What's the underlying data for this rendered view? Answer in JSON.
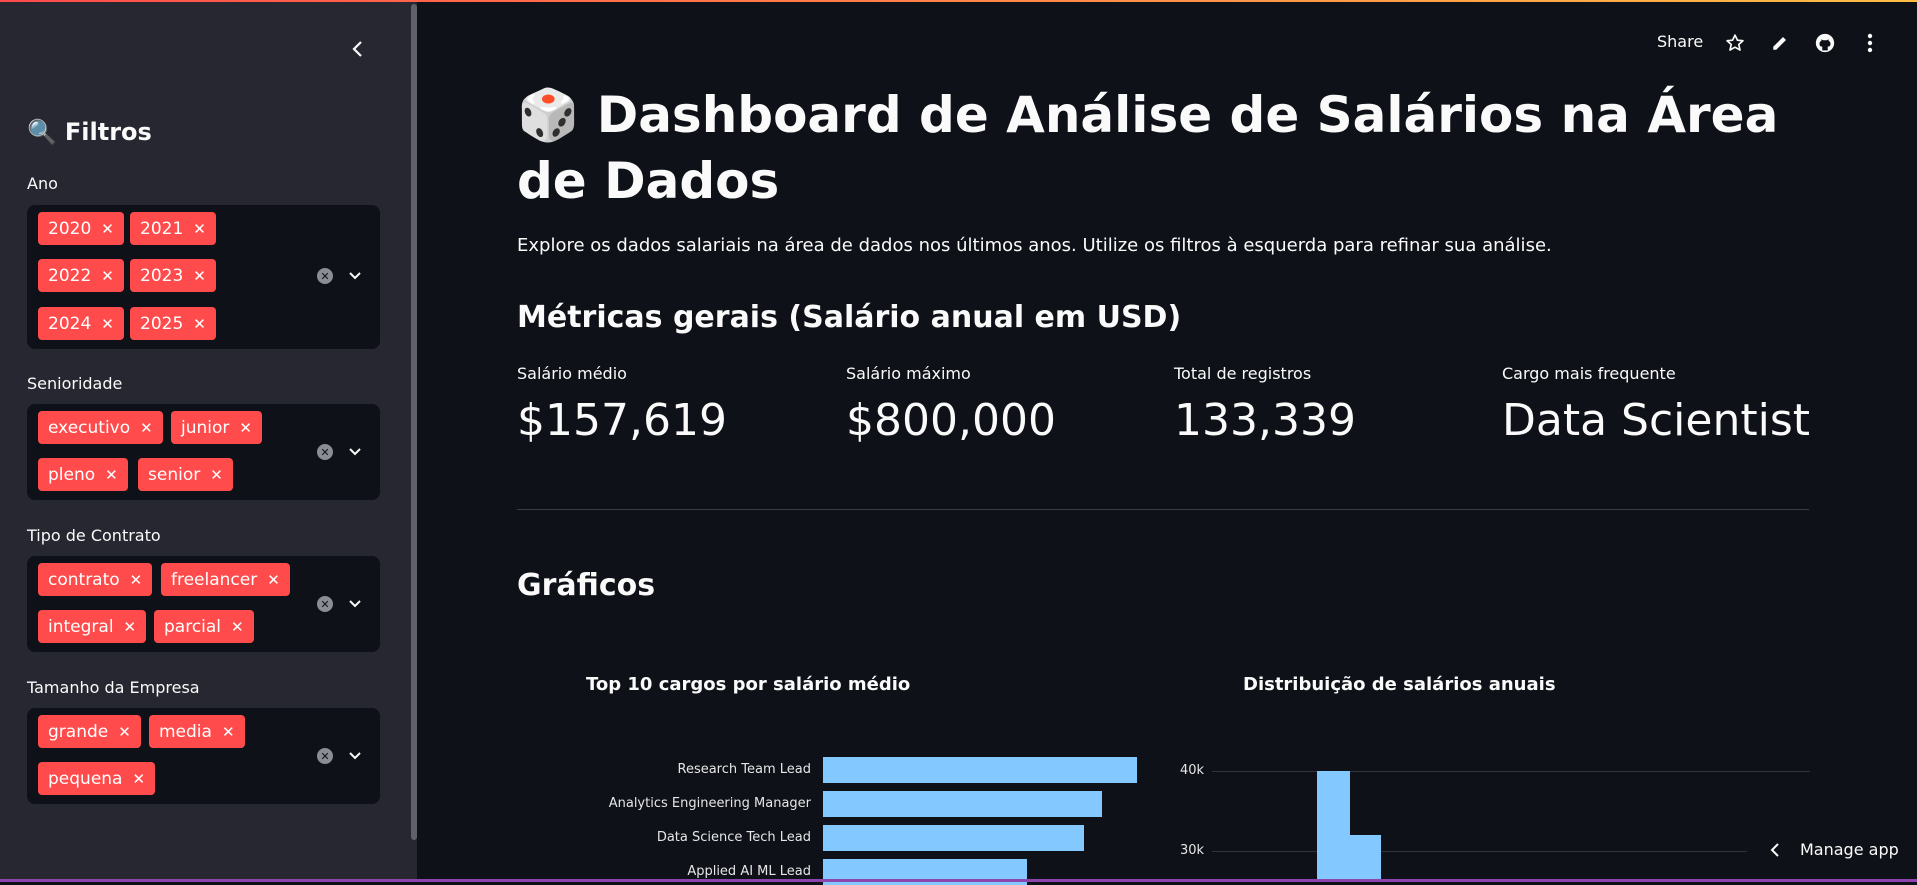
{
  "sidebar": {
    "title": "Filtros",
    "title_icon": "🔍",
    "filters": [
      {
        "label": "Ano",
        "tags": [
          "2020",
          "2021",
          "2022",
          "2023",
          "2024",
          "2025"
        ]
      },
      {
        "label": "Senioridade",
        "tags": [
          "executivo",
          "junior",
          "pleno",
          "senior"
        ]
      },
      {
        "label": "Tipo de Contrato",
        "tags": [
          "contrato",
          "freelancer",
          "integral",
          "parcial"
        ]
      },
      {
        "label": "Tamanho da Empresa",
        "tags": [
          "grande",
          "media",
          "pequena"
        ]
      }
    ],
    "tag_color": "#ff4b4b"
  },
  "header": {
    "share_label": "Share",
    "icons": [
      "star-icon",
      "pencil-icon",
      "github-icon",
      "more-menu-icon"
    ]
  },
  "main": {
    "title_emoji": "🎲",
    "title": "Dashboard de Análise de Salários na Área de Dados",
    "intro": "Explore os dados salariais na área de dados nos últimos anos. Utilize os filtros à esquerda para refinar sua análise.",
    "metrics_heading": "Métricas gerais (Salário anual em USD)",
    "metrics": [
      {
        "label": "Salário médio",
        "value": "$157,619"
      },
      {
        "label": "Salário máximo",
        "value": "$800,000"
      },
      {
        "label": "Total de registros",
        "value": "133,339"
      },
      {
        "label": "Cargo mais frequente",
        "value": "Data Scientist"
      }
    ],
    "charts_heading": "Gráficos"
  },
  "chart_data": [
    {
      "type": "bar",
      "title": "Top 10 cargos por salário médio",
      "orientation": "horizontal",
      "categories": [
        "Research Team Lead",
        "Analytics Engineering Manager",
        "Data Science Tech Lead",
        "Applied AI ML Lead"
      ],
      "values": [
        1.0,
        0.89,
        0.83,
        0.65
      ],
      "color": "#83c9ff"
    },
    {
      "type": "bar",
      "title": "Distribuição de salários anuais",
      "y_ticks": [
        "40k",
        "30k"
      ],
      "values": [
        40000,
        32000
      ],
      "color": "#83c9ff"
    }
  ],
  "footer": {
    "manage_app_label": "Manage app"
  }
}
